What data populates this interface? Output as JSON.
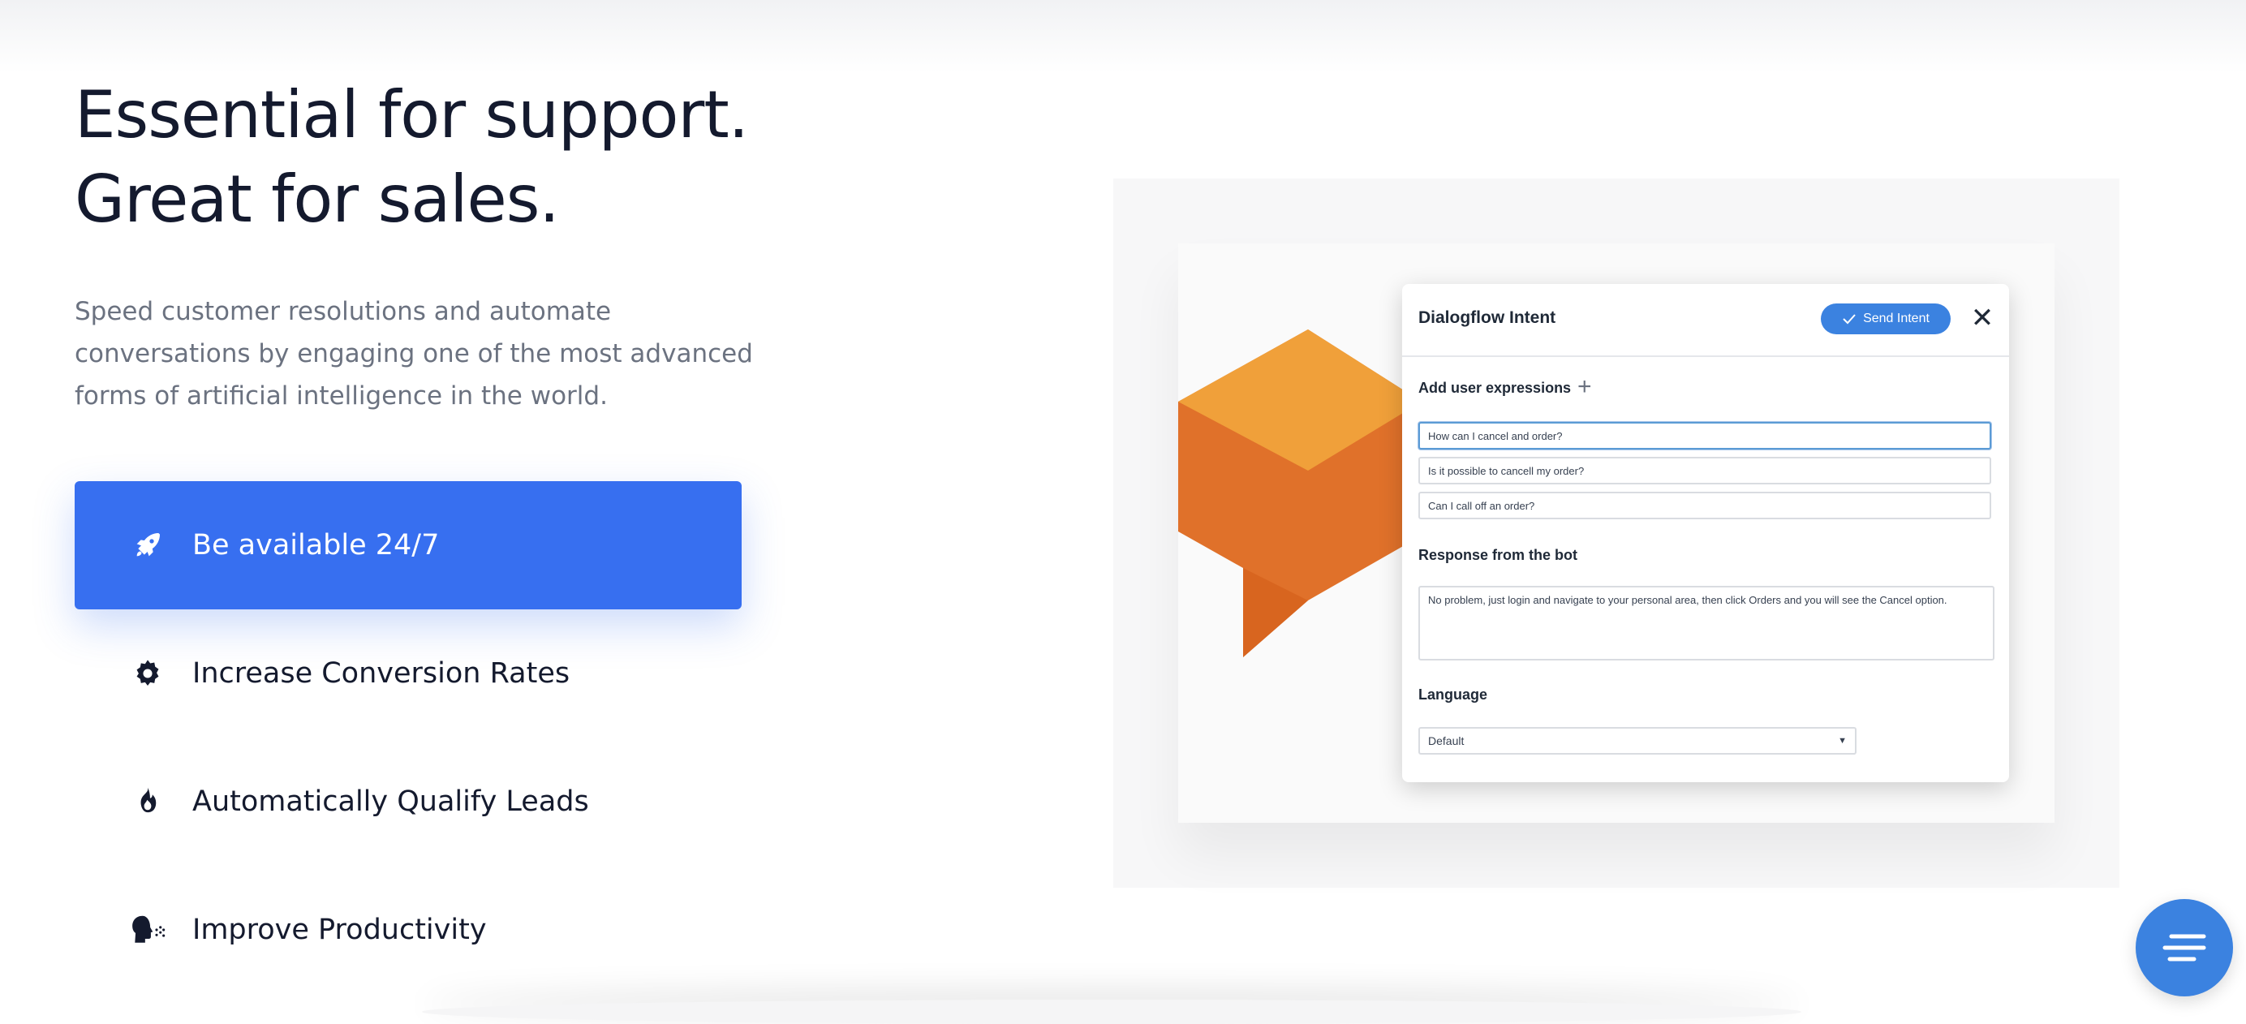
{
  "hero": {
    "headline_line1": "Essential for support.",
    "headline_line2": "Great for sales.",
    "subtext": "Speed customer resolutions and automate conversations by engaging one of the most advanced forms of artificial intelligence in the world."
  },
  "features": [
    {
      "label": "Be available 24/7",
      "icon": "rocket-icon",
      "active": true
    },
    {
      "label": "Increase Conversion Rates",
      "icon": "gear-icon",
      "active": false
    },
    {
      "label": "Automatically Qualify Leads",
      "icon": "flame-icon",
      "active": false
    },
    {
      "label": "Improve Productivity",
      "icon": "talking-head-icon",
      "active": false
    }
  ],
  "colors": {
    "accent": "#376ff0",
    "dialog_button": "#3b82e0",
    "heading": "#141a2e",
    "subtext": "#6b7280",
    "logo_orange": "#f0a03a",
    "logo_dark_orange": "#e0712a"
  },
  "dialog": {
    "title": "Dialogflow Intent",
    "send_label": "Send Intent",
    "user_expressions_label": "Add user expressions",
    "expressions": [
      "How can I cancel and order?",
      "Is it possible to cancell my order?",
      "Can I call off an order?"
    ],
    "response_label": "Response from the bot",
    "response_text": "No problem, just login and navigate to your personal area, then click Orders and you will see the Cancel option.",
    "language_label": "Language",
    "language_value": "Default"
  }
}
